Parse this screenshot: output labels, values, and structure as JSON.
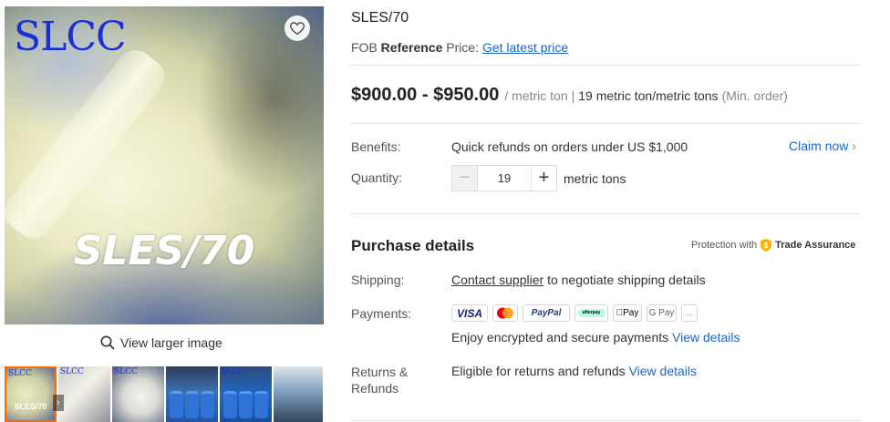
{
  "gallery": {
    "brand_text": "SLCC",
    "image_caption": "SLES/70",
    "view_larger": "View larger image",
    "thumbnails": [
      {
        "caption": "SLES/70",
        "brand": "SLCC",
        "active": true
      },
      {
        "caption": "",
        "brand": "SLCC",
        "active": false
      },
      {
        "caption": "",
        "brand": "SLCC",
        "active": false
      },
      {
        "caption": "",
        "brand": "",
        "active": false
      },
      {
        "caption": "",
        "brand": "SLCC",
        "active": false
      },
      {
        "caption": "",
        "brand": "",
        "active": false
      }
    ]
  },
  "product": {
    "title": "SLES/70",
    "fob_prefix": "FOB",
    "fob_bold": "Reference",
    "fob_suffix": "Price:",
    "fob_link": "Get latest price",
    "price_range": "$900.00 - $950.00",
    "price_unit": "/ metric ton",
    "price_sep": "|",
    "moq": "19 metric ton/metric tons",
    "moq_note": "(Min. order)"
  },
  "benefits": {
    "label": "Benefits:",
    "value": "Quick refunds on orders under US $1,000",
    "claim": "Claim now"
  },
  "quantity": {
    "label": "Quantity:",
    "value": "19",
    "minus": "−",
    "plus": "+",
    "unit": "metric tons"
  },
  "purchase": {
    "title": "Purchase details",
    "protection_prefix": "Protection with",
    "protection_brand": "Trade Assurance",
    "shipping_label": "Shipping:",
    "shipping_link": "Contact supplier",
    "shipping_text": "to negotiate shipping details",
    "payments_label": "Payments:",
    "payment_methods": [
      "VISA",
      "",
      "PayPal",
      "afterpay",
      "Pay",
      "G Pay",
      "..."
    ],
    "payments_text": "Enjoy encrypted and secure payments",
    "payments_link": "View details",
    "returns_label": "Returns & Refunds",
    "returns_text": "Eligible for returns and refunds",
    "returns_link": "View details"
  },
  "colors": {
    "accent_link": "#1a66c9",
    "active_thumb_border": "#ff6a00",
    "trade_assurance_shield": "#f5b800"
  }
}
